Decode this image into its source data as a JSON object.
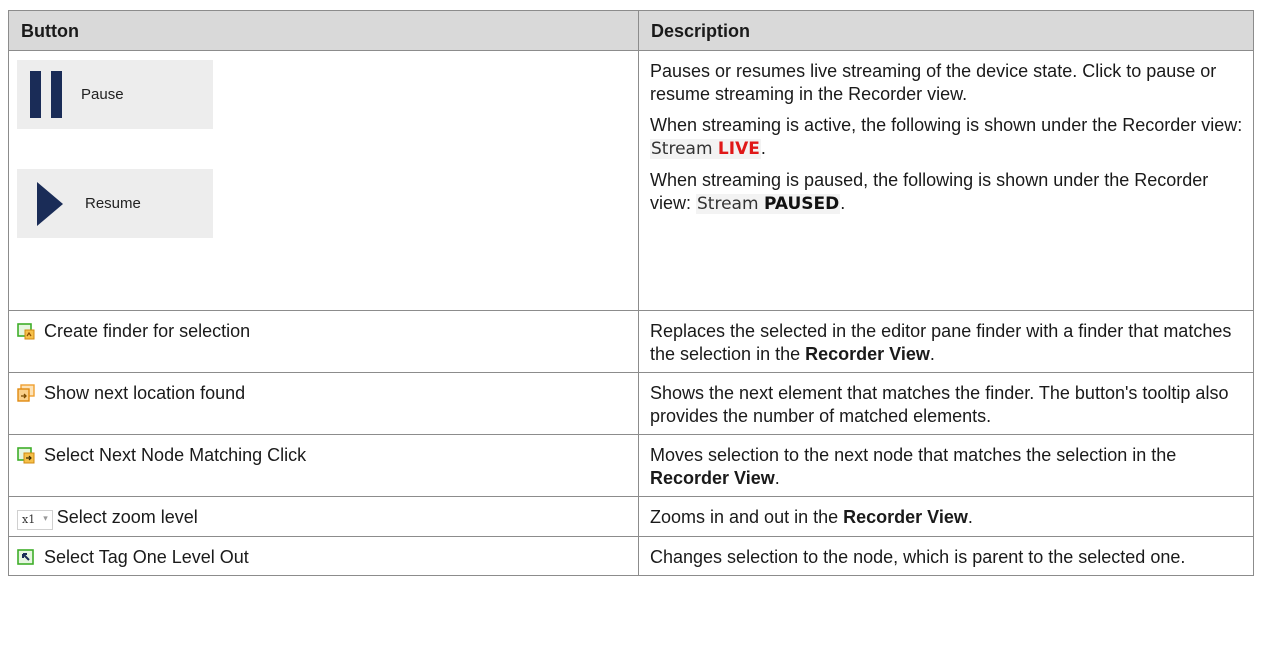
{
  "table": {
    "header": {
      "button": "Button",
      "description": "Description"
    },
    "row_pause": {
      "pause_label": "Pause",
      "resume_label": "Resume",
      "desc_p1": "Pauses or resumes live streaming of the device state. Click to pause or resume streaming in the Recorder view.",
      "desc_p2_text": "When streaming is active, the following is shown under the Recorder view: ",
      "stream_word": "Stream",
      "live_word": "LIVE",
      "desc_p3_text": "When streaming is paused, the following is shown under the Recorder view: ",
      "paused_word": "PAUSED",
      "period": "."
    },
    "row_create": {
      "label": "Create finder for selection",
      "desc_before": "Replaces the selected in the editor pane finder with a finder that matches the selection in the ",
      "desc_bold": "Recorder View",
      "desc_after": "."
    },
    "row_shownext": {
      "label": "Show next location found",
      "desc": "Shows the next element that matches the finder. The button's tooltip also provides the number of matched elements."
    },
    "row_selectnext": {
      "label": "Select Next Node Matching Click",
      "desc_before": "Moves selection to the next node that matches the selection in the ",
      "desc_bold": "Recorder View",
      "desc_after": "."
    },
    "row_zoom": {
      "zoom_value": "x1",
      "zoom_arrow": "▾",
      "label": "Select zoom level",
      "desc_before": "Zooms in and out in the ",
      "desc_bold": "Recorder View",
      "desc_after": "."
    },
    "row_tagout": {
      "label": "Select Tag One Level Out",
      "desc": "Changes selection to the node, which is parent to the selected one."
    }
  },
  "icons": {
    "create_finder": "create-finder-icon",
    "show_next": "show-next-location-icon",
    "select_next": "select-next-node-icon",
    "tag_out": "select-tag-out-icon"
  },
  "colors": {
    "header_bg": "#d9d9d9",
    "icon_navy": "#1a2c57",
    "live_red": "#e01818",
    "icon_green": "#3fae2a",
    "icon_orange": "#f0a030"
  }
}
